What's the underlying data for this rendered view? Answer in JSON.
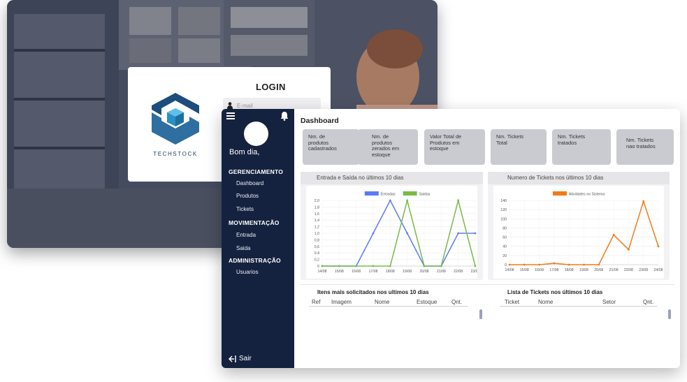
{
  "login": {
    "title": "LOGIN",
    "brand": "TECHSTOCK",
    "email_placeholder": "E-mail"
  },
  "sidebar": {
    "greeting": "Bom dia,",
    "sections": [
      {
        "label": "GERENCIAMENTO",
        "items": [
          "Dashboard",
          "Produtos",
          "Tickets"
        ]
      },
      {
        "label": "MOVIMENTAÇÃO",
        "items": [
          "Entrada",
          "Saida"
        ]
      },
      {
        "label": "ADMINISTRAÇÃO",
        "items": [
          "Usuarios"
        ]
      }
    ],
    "logout": "Sair"
  },
  "dashboard": {
    "title": "Dashboard",
    "cards": [
      [
        "Nm. de",
        "produtos",
        "cadastrados"
      ],
      [
        "Nm. de",
        "produtos",
        "zerados em",
        "estoque"
      ],
      [
        "Valor Total de",
        "Produtos em",
        "estoque"
      ],
      [
        "Nm. Tickets",
        "Total"
      ],
      [
        "Nm. Tickets",
        "tratados"
      ],
      [
        "Nm. Tickets",
        "nao tratados"
      ]
    ],
    "panel_left_title": "Entrada e Saída no últimos 10 dias",
    "panel_right_title": "Numero de Tickets nos últimos 10 dias",
    "table_left": {
      "title": "Itens mais solicitados nos ultimos 10 dias",
      "headers": [
        "Ref",
        "Imagem",
        "Nome",
        "Estoque",
        "Qnt."
      ]
    },
    "table_right": {
      "title": "Lista de Tickets nos últimos 10 dias",
      "headers": [
        "Ticket",
        "Nome",
        "Setor",
        "Qnt."
      ]
    }
  },
  "colors": {
    "sidebar": "#15223f",
    "entradas": "#5b7cf5",
    "saidas": "#79bb4a",
    "tickets": "#f27a17",
    "card": "#c9cbd0"
  },
  "chart_data": [
    {
      "type": "line",
      "categories": [
        "14/08",
        "15/08",
        "16/08",
        "17/08",
        "18/08",
        "19/08",
        "20/08",
        "21/08",
        "22/08",
        "23/08"
      ],
      "series": [
        {
          "name": "Entradas",
          "values": [
            0,
            0,
            0,
            1,
            2,
            1,
            0,
            0,
            1,
            1
          ]
        },
        {
          "name": "Saidas",
          "values": [
            0,
            0,
            0,
            0,
            0,
            2,
            0,
            0,
            2,
            0
          ]
        }
      ],
      "yticks": [
        "0",
        "0,2",
        "0,4",
        "0,6",
        "0,8",
        "1,0",
        "1,2",
        "1,4",
        "1,6",
        "1,8",
        "2,0"
      ],
      "ylim": [
        0,
        2
      ],
      "legend": "top"
    },
    {
      "type": "line",
      "categories": [
        "14/08",
        "15/08",
        "16/08",
        "17/08",
        "18/08",
        "19/08",
        "20/08",
        "21/08",
        "22/08",
        "23/08",
        "24/08"
      ],
      "series": [
        {
          "name": "Atividades no Sistema",
          "values": [
            0,
            0,
            0,
            3,
            0,
            0,
            0,
            65,
            33,
            138,
            40
          ]
        }
      ],
      "yticks": [
        "0",
        "20",
        "40",
        "60",
        "80",
        "100",
        "120",
        "140"
      ],
      "ylim": [
        0,
        140
      ],
      "legend": "top"
    }
  ]
}
